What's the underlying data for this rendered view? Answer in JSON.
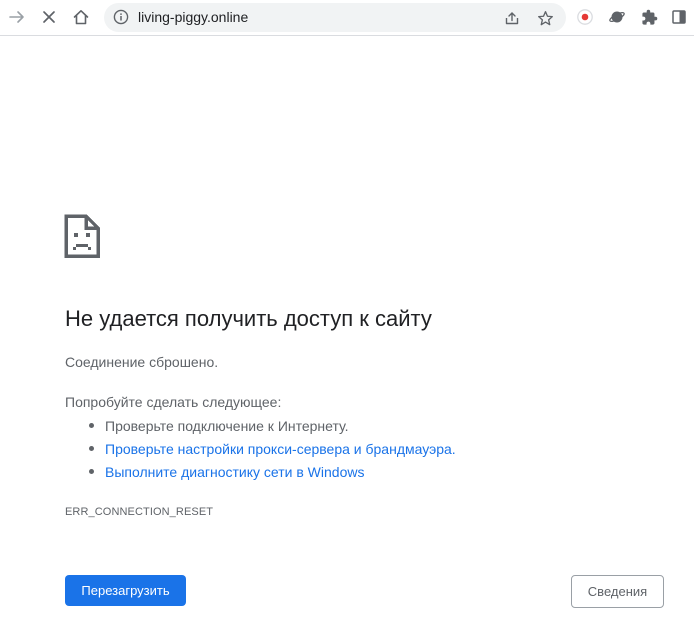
{
  "browser": {
    "url": "living-piggy.online",
    "icons": {
      "forward": "forward-arrow-icon",
      "stop": "stop-loading-icon",
      "home": "home-icon",
      "site_info": "info-icon",
      "share": "share-icon",
      "bookmark": "star-icon",
      "extension_1": "record-extension-icon",
      "extension_2": "planet-extension-icon",
      "extensions": "puzzle-icon",
      "side_panel": "side-panel-icon"
    },
    "colors": {
      "extension_record_red": "#e53935"
    }
  },
  "error_page": {
    "icon": "sad-page-icon",
    "title": "Не удается получить доступ к сайту",
    "subtitle": "Соединение сброшено.",
    "suggestions_title": "Попробуйте сделать следующее:",
    "suggestions": [
      {
        "text": "Проверьте подключение к Интернету.",
        "is_link": false
      },
      {
        "text": "Проверьте настройки прокси-сервера и брандмауэра.",
        "is_link": true
      },
      {
        "text": "Выполните диагностику сети в Windows",
        "is_link": true
      }
    ],
    "error_code": "ERR_CONNECTION_RESET",
    "reload_button": "Перезагрузить",
    "details_button": "Сведения",
    "colors": {
      "primary_blue": "#1a73e8",
      "text_gray": "#5f6368",
      "title_dark": "#202124"
    }
  }
}
